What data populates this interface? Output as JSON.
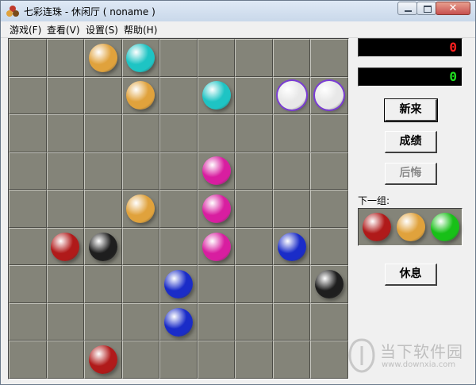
{
  "window": {
    "title": "七彩连珠 - 休闲厅 ( noname )"
  },
  "menu": [
    {
      "label": "游戏(F)"
    },
    {
      "label": "查看(V)"
    },
    {
      "label": "设置(S)"
    },
    {
      "label": "帮助(H)"
    }
  ],
  "colors": {
    "orange": "#e0a23c",
    "cyan": "#1ec4c4",
    "white": "#e8e8e8",
    "magenta": "#d81ea0",
    "red": "#b01a1a",
    "black": "#1e1e1e",
    "blue": "#1a2cc8",
    "green": "#18c018"
  },
  "board": {
    "rows": 9,
    "cols": 9,
    "balls": [
      {
        "row": 0,
        "col": 2,
        "color": "orange"
      },
      {
        "row": 0,
        "col": 3,
        "color": "cyan"
      },
      {
        "row": 1,
        "col": 3,
        "color": "orange"
      },
      {
        "row": 1,
        "col": 5,
        "color": "cyan"
      },
      {
        "row": 1,
        "col": 7,
        "color": "white",
        "selected": true
      },
      {
        "row": 1,
        "col": 8,
        "color": "white",
        "selected": true
      },
      {
        "row": 3,
        "col": 5,
        "color": "magenta"
      },
      {
        "row": 4,
        "col": 3,
        "color": "orange"
      },
      {
        "row": 4,
        "col": 5,
        "color": "magenta"
      },
      {
        "row": 5,
        "col": 1,
        "color": "red"
      },
      {
        "row": 5,
        "col": 2,
        "color": "black"
      },
      {
        "row": 5,
        "col": 5,
        "color": "magenta"
      },
      {
        "row": 5,
        "col": 7,
        "color": "blue"
      },
      {
        "row": 6,
        "col": 4,
        "color": "blue"
      },
      {
        "row": 6,
        "col": 8,
        "color": "black"
      },
      {
        "row": 7,
        "col": 4,
        "color": "blue"
      },
      {
        "row": 8,
        "col": 2,
        "color": "red"
      }
    ]
  },
  "scores": {
    "high": "0",
    "current": "0",
    "high_color": "#ff2020",
    "current_color": "#20e020"
  },
  "buttons": {
    "new_game": "新来",
    "score": "成绩",
    "undo": "后悔",
    "rest": "休息"
  },
  "next": {
    "label": "下一组:",
    "balls": [
      {
        "color": "red"
      },
      {
        "color": "orange"
      },
      {
        "color": "green"
      }
    ]
  },
  "watermark": {
    "title": "当下软件园",
    "url": "www.downxia.com"
  }
}
